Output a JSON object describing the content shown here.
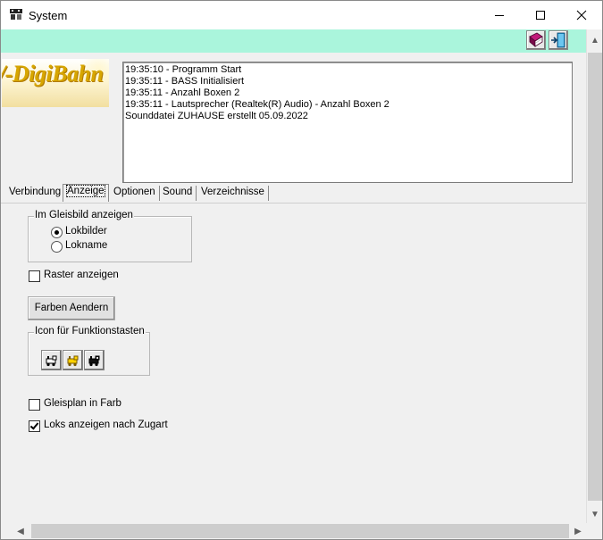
{
  "window": {
    "title": "System",
    "minimize_label": "–",
    "maximize_label": "□",
    "close_label": "✕"
  },
  "toolbar": {
    "icons": [
      "book-icon",
      "exit-door-icon"
    ],
    "toolbar_color": "#aaf5dc"
  },
  "logo": {
    "text": "/-DigiBahn"
  },
  "log": {
    "lines": [
      "19:35:10 - Programm Start",
      "19:35:11 - BASS Initialisiert",
      "19:35:11 - Anzahl Boxen 2",
      "19:35:11 - Lautsprecher (Realtek(R) Audio) - Anzahl Boxen 2",
      "Sounddatei ZUHAUSE  erstellt 05.09.2022"
    ]
  },
  "tabs": [
    {
      "label": "Verbindung",
      "active": false
    },
    {
      "label": "Anzeige",
      "active": true
    },
    {
      "label": "Optionen",
      "active": false
    },
    {
      "label": "Sound",
      "active": false
    },
    {
      "label": "Verzeichnisse",
      "active": false
    }
  ],
  "anzeige": {
    "gleisbild_group": {
      "title": "Im Gleisbild anzeigen",
      "options": [
        {
          "label": "Lokbilder",
          "selected": true
        },
        {
          "label": "Lokname",
          "selected": false
        }
      ]
    },
    "raster": {
      "label": "Raster anzeigen",
      "checked": false
    },
    "farben_button": {
      "label": "Farben Aendern"
    },
    "icon_group": {
      "title": "Icon für Funktionstasten",
      "icons": [
        "locomotive-icon-white",
        "locomotive-icon-yellow",
        "locomotive-icon-black"
      ]
    },
    "gleisplan": {
      "label": "Gleisplan in Farb",
      "checked": false
    },
    "zugart": {
      "label": "Loks anzeigen nach Zugart",
      "checked": true
    }
  }
}
